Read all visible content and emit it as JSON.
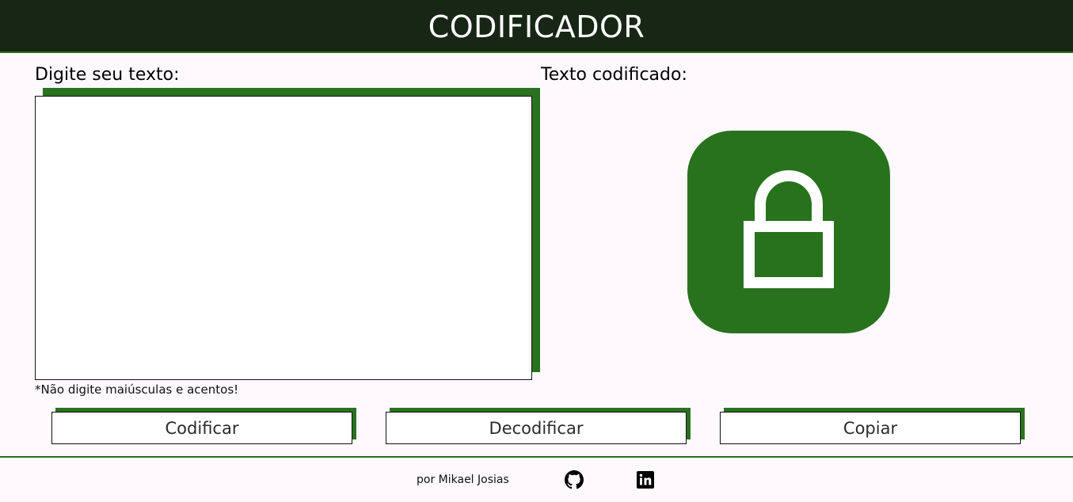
{
  "header": {
    "title": "CODIFICADOR"
  },
  "input_panel": {
    "label": "Digite seu texto:",
    "textarea_value": "",
    "hint": "*Não digite maiúsculas e acentos!"
  },
  "output_panel": {
    "label": "Texto codificado:",
    "icon": "lock-icon"
  },
  "buttons": {
    "encode_label": "Codificar",
    "decode_label": "Decodificar",
    "copy_label": "Copiar"
  },
  "footer": {
    "credit": "por Mikael Josias",
    "icons": [
      "github-icon",
      "linkedin-icon"
    ]
  },
  "colors": {
    "header_bg": "#182616",
    "accent_green": "#2a721f",
    "page_bg": "#fdf9fc"
  }
}
